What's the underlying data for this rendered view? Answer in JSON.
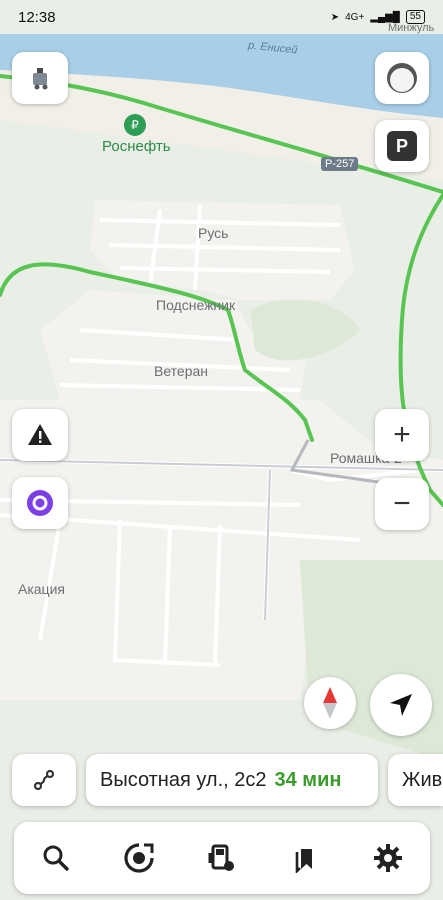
{
  "status_bar": {
    "time": "12:38",
    "network": "4G+",
    "battery": "55"
  },
  "map_labels": {
    "river": "р. Енисей",
    "city": "Минжуль",
    "fuel_station": "Роснефть",
    "road_badge": "Р-257",
    "rus": "Русь",
    "podsnezhnik": "Подснежник",
    "veteran": "Ветеран",
    "romashka": "Ромашка-2",
    "akaciya": "Акация"
  },
  "controls": {
    "parking": "P",
    "zoom_in": "+",
    "zoom_out": "−"
  },
  "routes": [
    {
      "address": "Высотная ул., 2с2",
      "time": "34 мин"
    },
    {
      "address": "Жив",
      "time": ""
    }
  ],
  "bottom_nav": [
    {
      "name": "search",
      "icon": "search-icon"
    },
    {
      "name": "navigator",
      "icon": "navigator-icon"
    },
    {
      "name": "fuel",
      "icon": "fuel-icon"
    },
    {
      "name": "bookmarks",
      "icon": "bookmarks-icon"
    },
    {
      "name": "settings",
      "icon": "gear-icon"
    }
  ],
  "colors": {
    "river": "#a9cfe8",
    "green_road": "#58c552",
    "accent_green": "#3a9d2b",
    "alice_purple": "#7b3fe4",
    "compass_red": "#e53935"
  }
}
